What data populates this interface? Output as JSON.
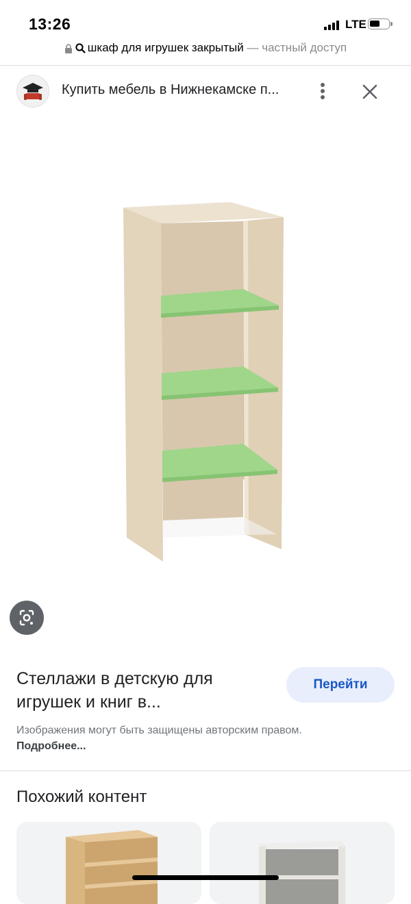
{
  "status_bar": {
    "time": "13:26",
    "network": "LTE",
    "icons": [
      "signal-icon",
      "battery-icon"
    ]
  },
  "url_bar": {
    "query": "шкаф для игрушек закрытый",
    "mode": " — частный доступ",
    "icons": [
      "lock-icon",
      "search-icon"
    ]
  },
  "viewer": {
    "site_title": "Купить мебель в Нижнекамске п...",
    "icons": [
      "site-favicon",
      "more-vert-icon",
      "close-icon",
      "lens-icon"
    ]
  },
  "result": {
    "title": "Стеллажи в детскую для игрушек и книг в...",
    "go_label": "Перейти",
    "copyright_text": "Изображения могут быть защищены авторским правом.",
    "more_link": "Подробнее..."
  },
  "similar": {
    "header": "Похожий контент"
  },
  "colors": {
    "shelf_wood": "#e3d4bc",
    "shelf_green": "#9fd68a",
    "accent_blue": "#1a56c7",
    "button_bg": "#e8eefc"
  }
}
